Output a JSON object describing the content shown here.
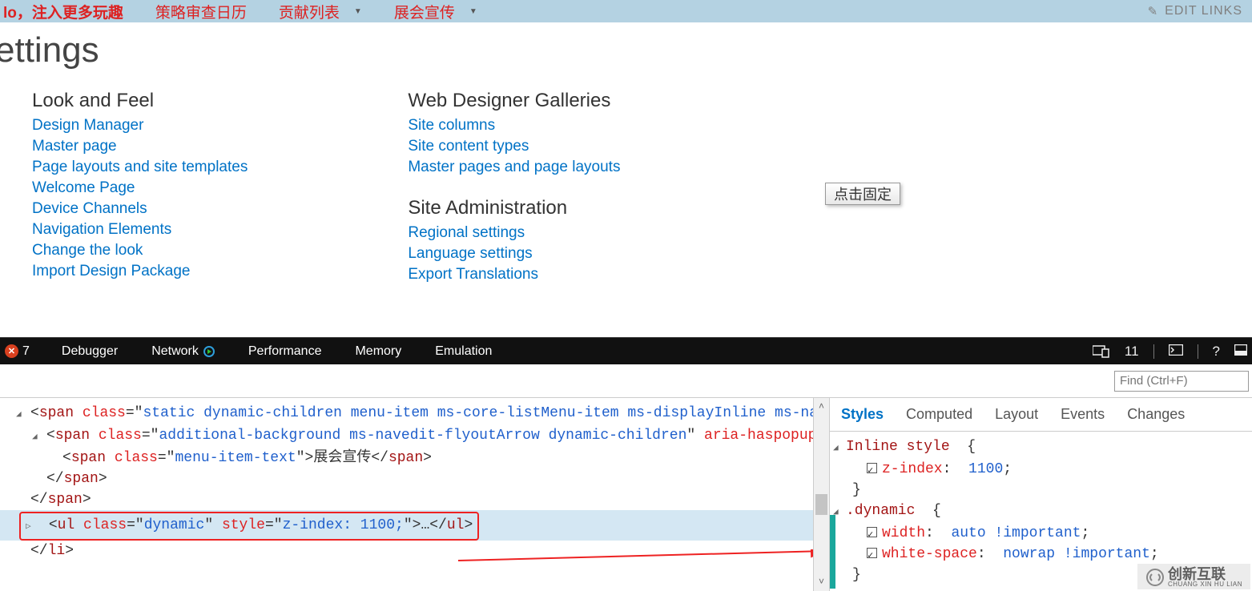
{
  "topnav": {
    "slogan": "lo，注入更多玩趣",
    "items": [
      {
        "label": "策略审查日历",
        "dropdown": false
      },
      {
        "label": "贡献列表",
        "dropdown": true
      },
      {
        "label": "展会宣传",
        "dropdown": true
      }
    ],
    "edit_links": "EDIT LINKS"
  },
  "page_title": "ettings",
  "settings": {
    "col1": {
      "heading": "Look and Feel",
      "links": [
        "Design Manager",
        "Master page",
        "Page layouts and site templates",
        "Welcome Page",
        "Device Channels",
        "Navigation Elements",
        "Change the look",
        "Import Design Package"
      ]
    },
    "col2a": {
      "heading": "Web Designer Galleries",
      "links": [
        "Site columns",
        "Site content types",
        "Master pages and page layouts"
      ]
    },
    "col2b": {
      "heading": "Site Administration",
      "links": [
        "Regional settings",
        "Language settings",
        "Export Translations"
      ]
    }
  },
  "pin_badge": "点击固定",
  "devtools": {
    "error_count": "7",
    "tabs": [
      "Debugger",
      "Network",
      "Performance",
      "Memory",
      "Emulation"
    ],
    "right_count": "11",
    "find_placeholder": "Find (Ctrl+F)",
    "dom": {
      "l1_tag": "span",
      "l1_class": "static dynamic-children menu-item ms-core-listMenu-item ms-displayInline ms-navedit-linkNode",
      "l2_tag": "span",
      "l2_class": "additional-background ms-navedit-flyoutArrow dynamic-children",
      "l2_attr_name": "aria-haspopup",
      "l2_attr_val": "true",
      "l3_tag": "span",
      "l3_class": "menu-item-text",
      "l3_text": "展会宣传",
      "close2": "span",
      "close1": "span",
      "l4_tag": "ul",
      "l4_class": "dynamic",
      "l4_style_attr": "style",
      "l4_style": "z-index: 1100;",
      "l4_ellipsis": "…",
      "close_li": "li"
    },
    "styles_tabs": [
      "Styles",
      "Computed",
      "Layout",
      "Events",
      "Changes"
    ],
    "styles_rules": {
      "inline_label": "Inline style",
      "inline_props": [
        {
          "name": "z-index",
          "value": "1100"
        }
      ],
      "dynamic_selector": ".dynamic",
      "dynamic_props": [
        {
          "name": "width",
          "value": "auto !important"
        },
        {
          "name": "white-space",
          "value": "nowrap !important"
        }
      ]
    }
  },
  "watermark": {
    "brand": "创新互联",
    "sub": "CHUANG XIN HU LIAN"
  }
}
